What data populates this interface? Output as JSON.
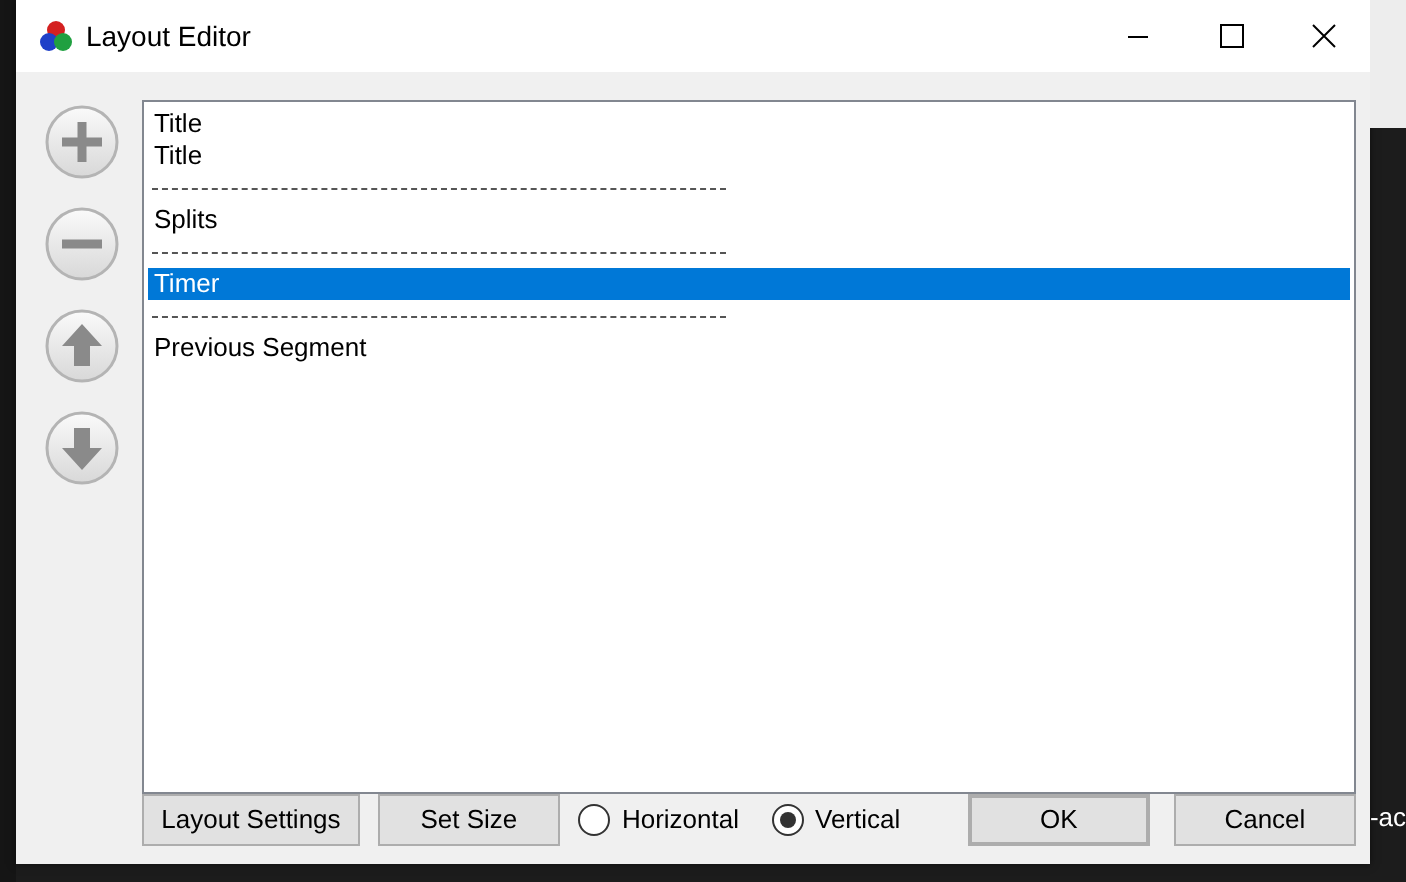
{
  "window": {
    "title": "Layout Editor"
  },
  "side_buttons": [
    {
      "kind": "add"
    },
    {
      "kind": "remove"
    },
    {
      "kind": "up"
    },
    {
      "kind": "down"
    }
  ],
  "list": [
    {
      "kind": "item",
      "label": "Title",
      "selected": false
    },
    {
      "kind": "item",
      "label": "Title",
      "selected": false
    },
    {
      "kind": "separator"
    },
    {
      "kind": "item",
      "label": "Splits",
      "selected": false
    },
    {
      "kind": "separator"
    },
    {
      "kind": "item",
      "label": "Timer",
      "selected": true
    },
    {
      "kind": "separator"
    },
    {
      "kind": "item",
      "label": "Previous Segment",
      "selected": false
    }
  ],
  "buttons": {
    "layout_settings": "Layout Settings",
    "set_size": "Set Size",
    "ok": "OK",
    "cancel": "Cancel"
  },
  "orientation": [
    {
      "label": "Horizontal",
      "selected": false
    },
    {
      "label": "Vertical",
      "selected": true
    }
  ],
  "background_text": "-ac"
}
